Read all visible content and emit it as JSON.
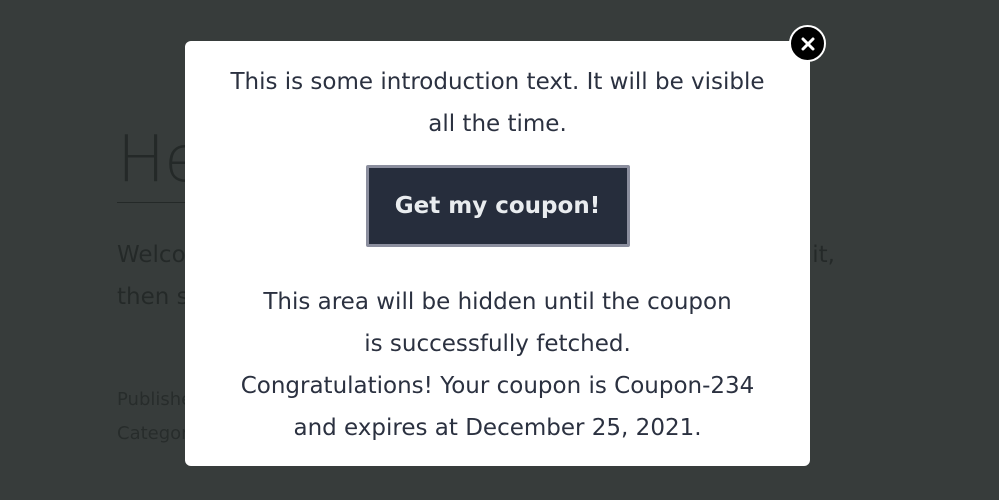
{
  "background_page": {
    "title": "He",
    "body_text": "Welco then start w",
    "meta": {
      "published": "Publish",
      "category": "Catego"
    }
  },
  "modal": {
    "intro_text": "This is some introduction text. It will be visible all the time.",
    "coupon_button_label": "Get my coupon!",
    "hidden_note": "This area will be hidden until the coupon is successfully fetched.",
    "congrats_text": "Congratulations! Your coupon is Coupon-234 and expires at December 25, 2021.",
    "close_icon": "close-icon"
  },
  "colors": {
    "overlay": "#262b2a",
    "button_bg": "#262d3c",
    "button_border": "#8b8e9e",
    "close_bg": "#000000"
  }
}
